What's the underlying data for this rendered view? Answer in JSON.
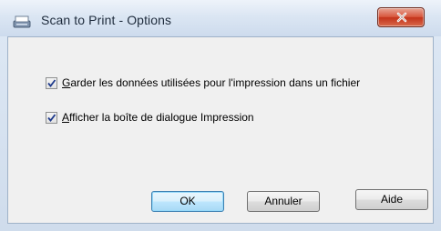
{
  "window": {
    "title": "Scan to Print - Options",
    "close_glyph": "X"
  },
  "options": [
    {
      "label_mnemonic": "G",
      "label_rest": "arder les données utilisées pour l'impression dans un fichier",
      "checked": true
    },
    {
      "label_mnemonic": "A",
      "label_rest": "fficher la boîte de dialogue Impression",
      "checked": true
    }
  ],
  "buttons": {
    "ok": "OK",
    "cancel": "Annuler",
    "help": "Aide"
  },
  "icons": {
    "title": "scanner-icon",
    "close": "close-icon",
    "check": "checkmark-icon"
  },
  "colors": {
    "close_button": "#c4331a",
    "default_button_border": "#3c7fb1",
    "checkmark": "#1f3b8c"
  }
}
